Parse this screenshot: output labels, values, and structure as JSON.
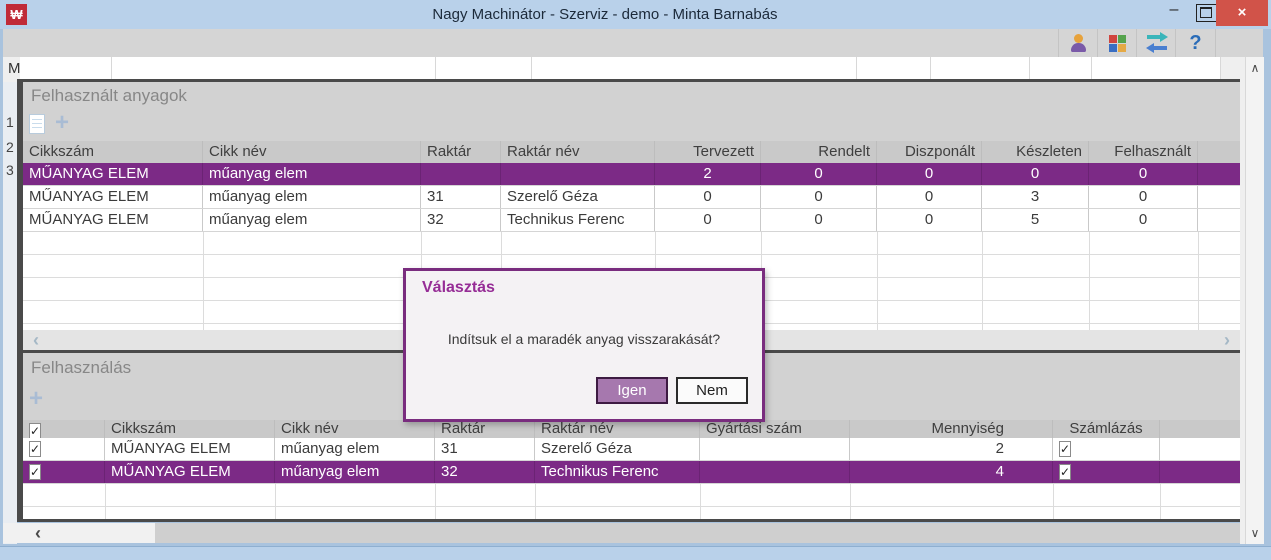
{
  "window": {
    "title": "Nagy Machinátor - Szerviz - demo - Minta Barnabás"
  },
  "icons": {
    "minimize": "–",
    "close": "×",
    "question": "?",
    "plus": "+",
    "check": "✓",
    "chevron_left": "‹",
    "chevron_right": "›",
    "chevron_up": "∧",
    "chevron_down": "∨",
    "logo": "₩"
  },
  "background": {
    "partial_text": "M",
    "row_numbers": [
      "1",
      "2",
      "3"
    ]
  },
  "materials": {
    "title": "Felhasznált anyagok",
    "columns": [
      "Cikkszám",
      "Cikk név",
      "Raktár",
      "Raktár név",
      "Tervezett",
      "Rendelt",
      "Diszponált",
      "Készleten",
      "Felhasznált"
    ],
    "rows": [
      [
        "MŰANYAG ELEM",
        "műanyag elem",
        "",
        "",
        "2",
        "0",
        "0",
        "0",
        "0"
      ],
      [
        "MŰANYAG ELEM",
        "műanyag elem",
        "31",
        "Szerelő Géza",
        "0",
        "0",
        "0",
        "3",
        "0"
      ],
      [
        "MŰANYAG ELEM",
        "műanyag elem",
        "32",
        "Technikus Ferenc",
        "0",
        "0",
        "0",
        "5",
        "0"
      ]
    ]
  },
  "usage": {
    "title": "Felhasználás",
    "columns": [
      "Cikkszám",
      "Cikk név",
      "Raktár",
      "Raktár név",
      "Gyártási szám",
      "Mennyiség",
      "Számlázás"
    ],
    "rows": [
      [
        "MŰANYAG ELEM",
        "műanyag elem",
        "31",
        "Szerelő Géza",
        "",
        "2"
      ],
      [
        "MŰANYAG ELEM",
        "műanyag elem",
        "32",
        "Technikus Ferenc",
        "",
        "4"
      ]
    ]
  },
  "dialog": {
    "title": "Választás",
    "message": "Indítsuk el a maradék anyag visszarakását?",
    "yes_label": "Igen",
    "no_label": "Nem"
  },
  "colors": {
    "accent_purple": "#7c2a86",
    "titlebar_blue": "#b9d1ea",
    "close_red": "#d15349"
  }
}
